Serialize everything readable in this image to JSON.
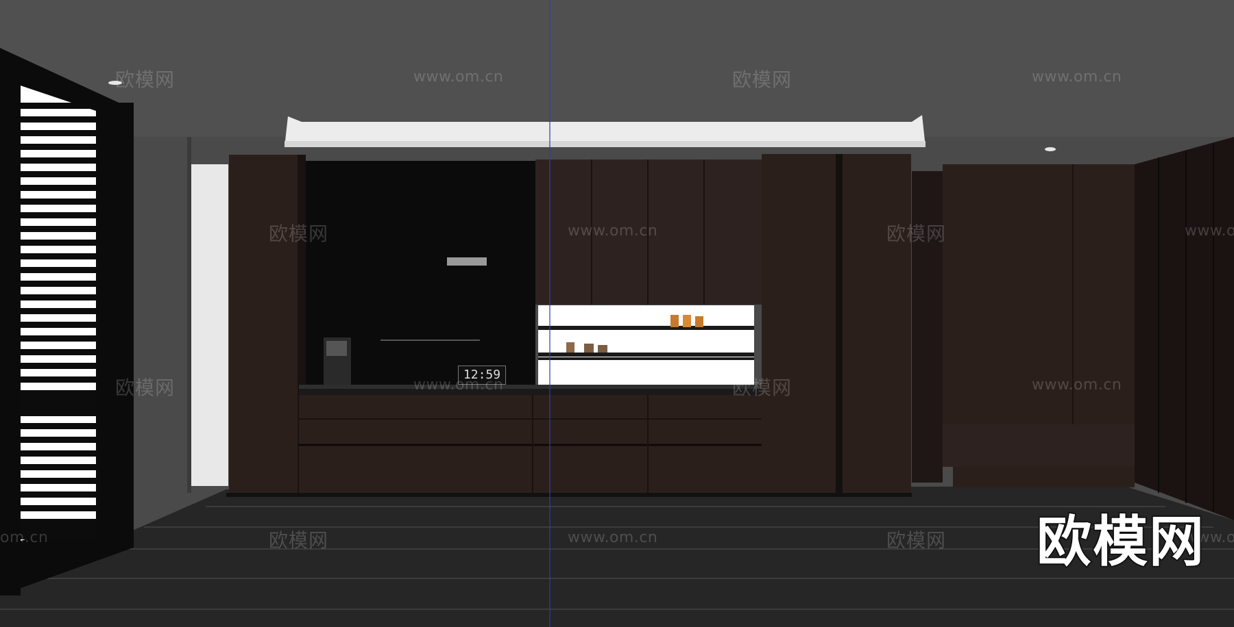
{
  "watermarks": {
    "brand": "欧模网",
    "url": "www.om.cn",
    "partial_url": "om.cn"
  },
  "logo": {
    "text": "欧模网"
  },
  "clock": {
    "display": "12:59"
  },
  "colors": {
    "ceiling": "#4d4d4d",
    "wall": "#4a4a4a",
    "cabinet": "#2b1f1c",
    "backsplash": "#0b0b0b",
    "floor": "#262626",
    "shutter": "#0c0c0c",
    "soffit": "#e8e8e8",
    "shelf_light": "#ffffff"
  }
}
